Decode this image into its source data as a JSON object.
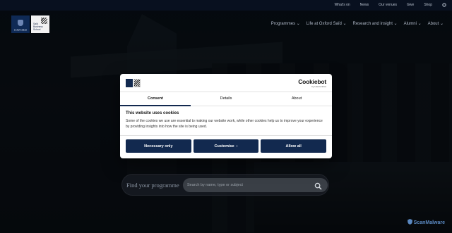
{
  "utility_nav": [
    "What's on",
    "News",
    "Our venues",
    "Give",
    "Shop"
  ],
  "logos": {
    "oxford_text": "OXFORD",
    "school_text": [
      "Saïd",
      "Business",
      "School"
    ]
  },
  "main_nav": [
    "Programmes ⌄",
    "Life at Oxford Saïd ⌄",
    "Research and insight ⌄",
    "Alumni ⌄",
    "About ⌄"
  ],
  "search": {
    "label": "Find your programme",
    "placeholder": "Search by name, type or subject"
  },
  "cookie": {
    "brand": "Cookiebot",
    "brand_sub": "by Usercentrics",
    "tabs": [
      "Consent",
      "Details",
      "About"
    ],
    "active_tab": "Consent",
    "title": "This website uses cookies",
    "text": "Some of the cookies we use are essential to making our website work, while other cookies help us to improve your experience by providing insights into how the site is being used.",
    "buttons": {
      "necessary": "Necessary only",
      "customise": "Customise",
      "allow": "Allow all"
    }
  },
  "watermark": "ScanMalware",
  "colors": {
    "brand_navy": "#12294f",
    "topbar": "#0a1428"
  }
}
